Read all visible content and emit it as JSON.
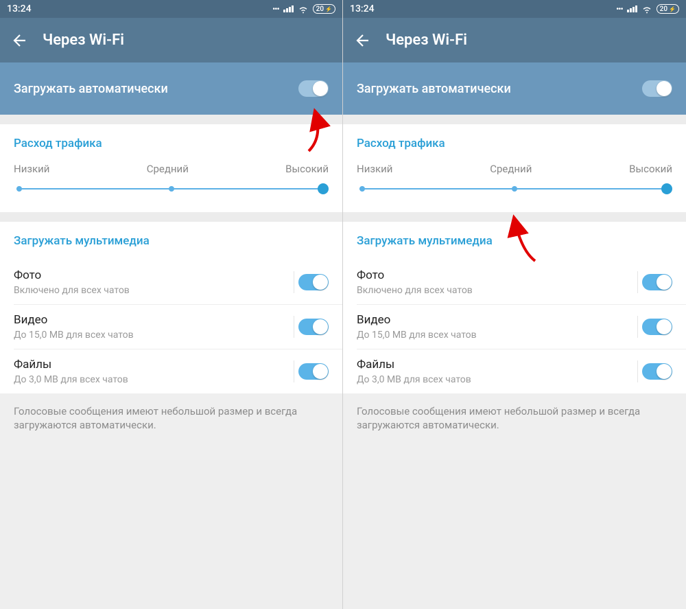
{
  "left": {
    "status": {
      "time": "13:24",
      "battery": "20"
    },
    "header": {
      "title": "Через Wi-Fi"
    },
    "auto": {
      "label": "Загружать автоматически",
      "on": true
    },
    "traffic": {
      "title": "Расход трафика",
      "low": "Низкий",
      "mid": "Средний",
      "high": "Высокий",
      "thumb_pos": "right"
    },
    "media": {
      "title": "Загружать мультимедиа",
      "items": [
        {
          "title": "Фото",
          "sub": "Включено для всех чатов",
          "on": true
        },
        {
          "title": "Видео",
          "sub": "До 15,0 МВ для всех чатов",
          "on": true
        },
        {
          "title": "Файлы",
          "sub": "До 3,0 МВ для всех чатов",
          "on": true
        }
      ]
    },
    "note": "Голосовые сообщения имеют небольшой размер и всегда загружаются автоматически.",
    "arrow_at": "toggle"
  },
  "right": {
    "status": {
      "time": "13:24",
      "battery": "20"
    },
    "header": {
      "title": "Через Wi-Fi"
    },
    "auto": {
      "label": "Загружать автоматически",
      "on": true
    },
    "traffic": {
      "title": "Расход трафика",
      "low": "Низкий",
      "mid": "Средний",
      "high": "Высокий",
      "thumb_pos": "right"
    },
    "media": {
      "title": "Загружать мультимедиа",
      "items": [
        {
          "title": "Фото",
          "sub": "Включено для всех чатов",
          "on": true
        },
        {
          "title": "Видео",
          "sub": "До 15,0 МВ для всех чатов",
          "on": true
        },
        {
          "title": "Файлы",
          "sub": "До 3,0 МВ для всех чатов",
          "on": true
        }
      ]
    },
    "note": "Голосовые сообщения имеют небольшой размер и всегда загружаются автоматически.",
    "arrow_at": "slider"
  }
}
